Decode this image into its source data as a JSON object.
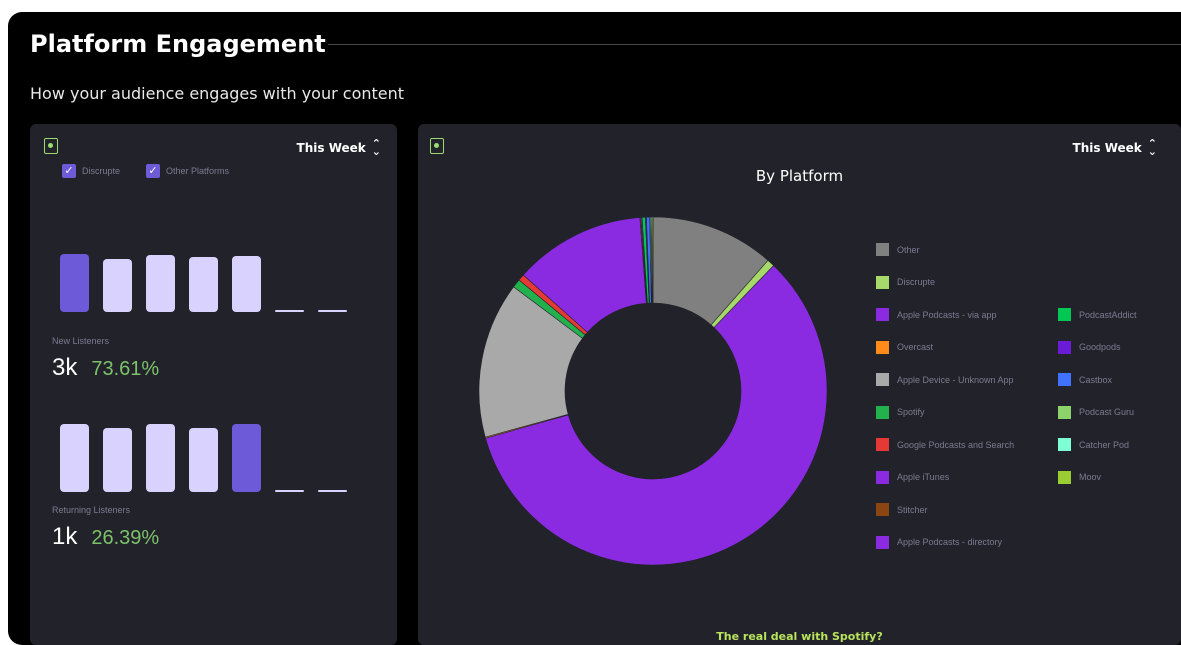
{
  "header": {
    "title": "Platform Engagement",
    "subtitle": "How your audience engages with your content"
  },
  "left_card": {
    "period": "This Week",
    "legend": [
      "Discrupte",
      "Other Platforms"
    ],
    "new_listeners": {
      "label": "New Listeners",
      "value": "3k",
      "percent": "73.61%",
      "bars": [
        {
          "level": 1.0,
          "highlight": true
        },
        {
          "level": 0.92,
          "highlight": false
        },
        {
          "level": 0.98,
          "highlight": false
        },
        {
          "level": 0.95,
          "highlight": false
        },
        {
          "level": 0.97,
          "highlight": false
        },
        {
          "level": 0,
          "highlight": false
        },
        {
          "level": 0,
          "highlight": false
        }
      ]
    },
    "returning_listeners": {
      "label": "Returning Listeners",
      "value": "1k",
      "percent": "26.39%",
      "bars": [
        {
          "level": 1.0,
          "highlight": false
        },
        {
          "level": 0.94,
          "highlight": false
        },
        {
          "level": 1.0,
          "highlight": false
        },
        {
          "level": 0.94,
          "highlight": false
        },
        {
          "level": 1.0,
          "highlight": true
        },
        {
          "level": 0,
          "highlight": false
        },
        {
          "level": 0,
          "highlight": false
        }
      ]
    },
    "colors": {
      "highlight": "#6c5ad8",
      "normal": "#d9d2ff"
    }
  },
  "right_card": {
    "period": "This Week",
    "footer_link": "The real deal with Spotify?",
    "chart_data": {
      "type": "pie",
      "title": "By Platform",
      "series": [
        {
          "name": "Other",
          "value": 11.5,
          "color": "#808080"
        },
        {
          "name": "Discrupte",
          "value": 0.7,
          "color": "#a6d96a"
        },
        {
          "name": "Apple Podcasts - via app",
          "value": 58.5,
          "color": "#8a2be2"
        },
        {
          "name": "Overcast",
          "value": 0.1,
          "color": "#ff8c1a"
        },
        {
          "name": "Apple Device - Unknown App",
          "value": 14.5,
          "color": "#a9a9a9"
        },
        {
          "name": "Spotify",
          "value": 0.8,
          "color": "#22b14c"
        },
        {
          "name": "Google Podcasts and Search",
          "value": 0.6,
          "color": "#e53935"
        },
        {
          "name": "Apple iTunes",
          "value": 12.2,
          "color": "#8a2be2"
        },
        {
          "name": "Stitcher",
          "value": 0.1,
          "color": "#8b4513"
        },
        {
          "name": "Apple Podcasts - directory",
          "value": 0.1,
          "color": "#8a2be2"
        },
        {
          "name": "PodcastAddict",
          "value": 0.3,
          "color": "#00c853"
        },
        {
          "name": "Goodpods",
          "value": 0.1,
          "color": "#6a1bd6"
        },
        {
          "name": "Castbox",
          "value": 0.3,
          "color": "#3f72ff"
        },
        {
          "name": "Podcast Guru",
          "value": 0.1,
          "color": "#8bd36a"
        },
        {
          "name": "Catcher Pod",
          "value": 0.1,
          "color": "#7fffd4"
        },
        {
          "name": "Moov",
          "value": 0.1,
          "color": "#9acd32"
        }
      ]
    }
  }
}
